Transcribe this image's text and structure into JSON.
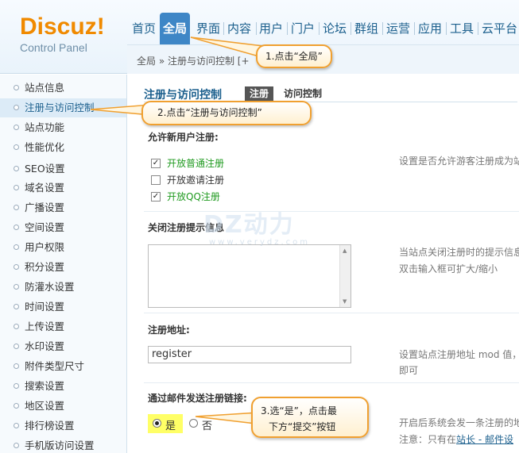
{
  "logo": {
    "main": "Discuz!",
    "sub": "Control Panel"
  },
  "nav": [
    {
      "label": "首页",
      "active": false
    },
    {
      "label": "全局",
      "active": true
    },
    {
      "label": "界面",
      "active": false
    },
    {
      "label": "内容",
      "active": false
    },
    {
      "label": "用户",
      "active": false
    },
    {
      "label": "门户",
      "active": false
    },
    {
      "label": "论坛",
      "active": false
    },
    {
      "label": "群组",
      "active": false
    },
    {
      "label": "运营",
      "active": false
    },
    {
      "label": "应用",
      "active": false
    },
    {
      "label": "工具",
      "active": false
    },
    {
      "label": "云平台",
      "active": false
    }
  ],
  "breadcrumb": "全局 » 注册与访问控制  [+",
  "sidebar": [
    "站点信息",
    "注册与访问控制",
    "站点功能",
    "性能优化",
    "SEO设置",
    "域名设置",
    "广播设置",
    "空间设置",
    "用户权限",
    "积分设置",
    "防灌水设置",
    "时间设置",
    "上传设置",
    "水印设置",
    "附件类型尺寸",
    "搜索设置",
    "地区设置",
    "排行榜设置",
    "手机版访问设置"
  ],
  "page": {
    "title": "注册与访问控制",
    "tab_active": "注册",
    "tab_label": "访问控制"
  },
  "sections": {
    "allow_register": {
      "title": "允许新用户注册:",
      "options": [
        {
          "label": "开放普通注册",
          "checked": true
        },
        {
          "label": "开放邀请注册",
          "checked": false
        },
        {
          "label": "开放QQ注册",
          "checked": true
        }
      ],
      "desc": "设置是否允许游客注册成为站"
    },
    "closed_message": {
      "title": "关闭注册提示信息",
      "desc_line1": "当站点关闭注册时的提示信息",
      "desc_line2": "双击输入框可扩大/缩小"
    },
    "register_url": {
      "title": "注册地址:",
      "value": "register",
      "desc_line1": "设置站点注册地址 mod 值，",
      "desc_line2": "即可"
    },
    "email_link": {
      "title": "通过邮件发送注册链接:",
      "yes": "是",
      "no": "否",
      "desc_line1": "开启后系统会发一条注册的地",
      "desc_prefix": "注意：只有在",
      "desc_link": "站长 - 邮件设"
    }
  },
  "watermark": {
    "main": "DZ动力",
    "sub": "www.verydz.com"
  },
  "callouts": {
    "c1": "1.点击“全局”",
    "c2": "2.点击“注册与访问控制”",
    "c3_line1": "3.选“是”，点击最",
    "c3_line2": "下方“提交”按钮"
  },
  "colors": {
    "accent": "#3e86c6",
    "logo": "#f08a00",
    "callout_border": "#f0a030",
    "highlight": "#ffff66"
  }
}
